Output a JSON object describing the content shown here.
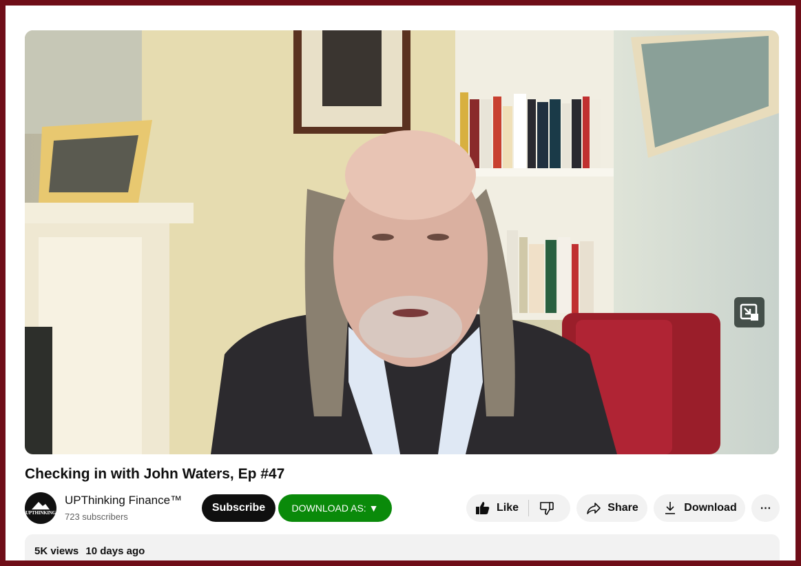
{
  "video": {
    "title": "Checking in with John Waters, Ep #47"
  },
  "channel": {
    "name": "UPThinking Finance™",
    "subscribers": "723 subscribers",
    "avatar_text": "UPTHINKING"
  },
  "actions": {
    "subscribe_label": "Subscribe",
    "download_as_label": "DOWNLOAD AS: ▼",
    "like_label": "Like",
    "share_label": "Share",
    "download_label": "Download",
    "more_label": "⋯"
  },
  "description": {
    "views": "5K views",
    "date": "10 days ago"
  },
  "icons": {
    "like": "thumbs-up-icon",
    "dislike": "thumbs-down-icon",
    "share": "share-arrow-icon",
    "download": "download-icon",
    "more": "more-horizontal-icon",
    "miniplayer": "miniplayer-icon"
  },
  "colors": {
    "border": "#6f0e18",
    "subscribe_bg": "#0f0f0f",
    "download_as_bg": "#0a8a0a",
    "pill_bg": "#f2f2f2"
  }
}
